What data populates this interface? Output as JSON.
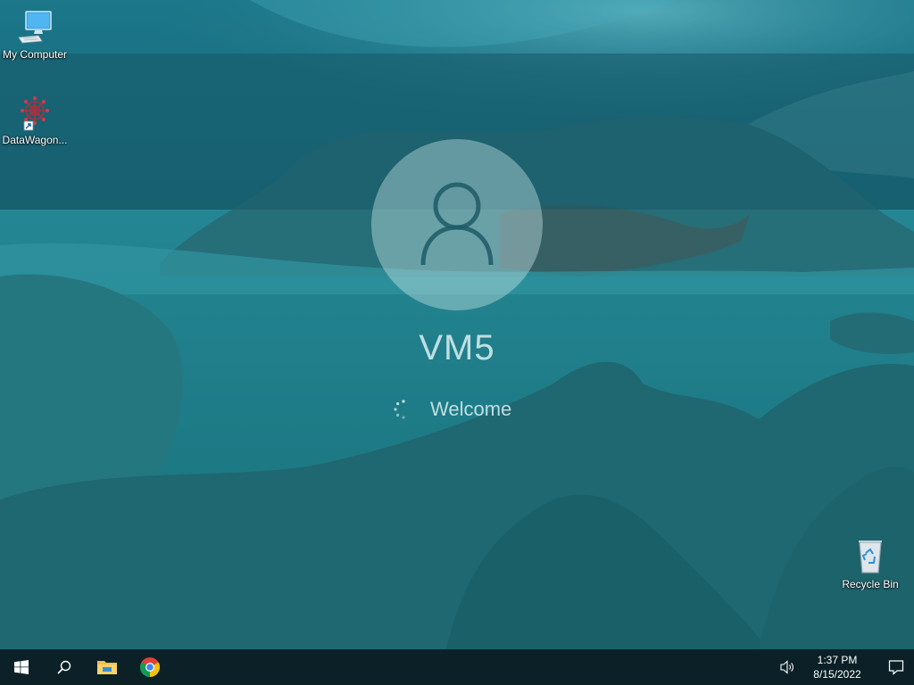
{
  "desktop": {
    "icons": [
      {
        "label": "My Computer",
        "icon": "computer-icon"
      },
      {
        "label": "DataWagon...",
        "icon": "datawagon-app-icon"
      },
      {
        "label": "Recycle Bin",
        "icon": "recycle-bin-icon"
      }
    ]
  },
  "login": {
    "user_icon": "user-avatar-icon",
    "username": "VM5",
    "status": "Welcome"
  },
  "taskbar": {
    "start_icon": "windows-start-icon",
    "search_icon": "search-icon",
    "pinned": [
      {
        "icon": "file-explorer-icon"
      },
      {
        "icon": "chrome-icon"
      }
    ],
    "tray": {
      "volume_icon": "volume-icon",
      "time": "1:37 PM",
      "date": "8/15/2022",
      "notification_icon": "action-center-icon"
    }
  },
  "colors": {
    "taskbar": "#0c1a1e",
    "overlay": "#185868",
    "text": "#dcf0f2"
  }
}
